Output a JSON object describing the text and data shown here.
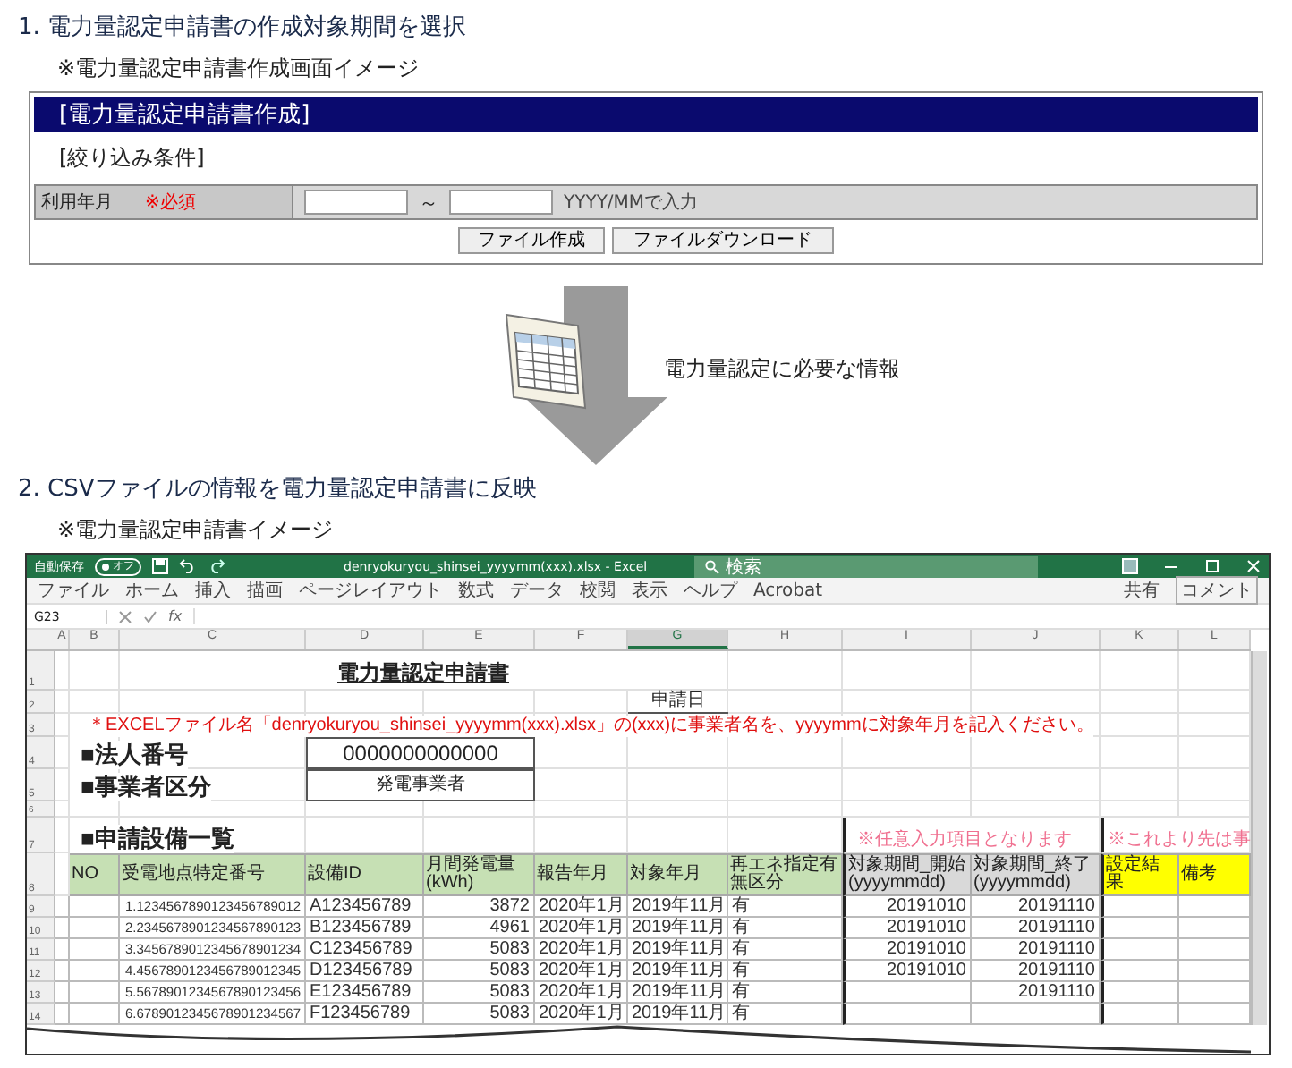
{
  "section1": {
    "heading": "1. 電力量認定申請書の作成対象期間を選択",
    "caption": "※電力量認定申請書作成画面イメージ",
    "form": {
      "title": "[電力量認定申請書作成]",
      "subtitle": "[絞り込み条件]",
      "field_label": "利用年月",
      "required": "※必須",
      "separator": "～",
      "hint": "YYYY/MMで入力",
      "buttons": [
        "ファイル作成",
        "ファイルダウンロード"
      ]
    }
  },
  "transition": {
    "label": "電力量認定に必要な情報"
  },
  "section2": {
    "heading": "2. CSVファイルの情報を電力量認定申請書に反映",
    "caption": "※電力量認定申請書イメージ",
    "excel": {
      "title_bar": {
        "autosave": "自動保存",
        "autosave_toggle": {
          "label": "オフ",
          "on": false
        },
        "filename": "denryokuryou_shinsei_yyyymm(xxx).xlsx - Excel",
        "search": "検索"
      },
      "menu": [
        "ファイル",
        "ホーム",
        "挿入",
        "描画",
        "ページレイアウト",
        "数式",
        "データ",
        "校閲",
        "表示",
        "ヘルプ",
        "Acrobat"
      ],
      "share": "共有",
      "comment": "コメント",
      "name_box": "G23",
      "function_label": "fx",
      "columns": [
        {
          "label": "A",
          "selected": false
        },
        {
          "label": "B",
          "selected": false
        },
        {
          "label": "C",
          "selected": false
        },
        {
          "label": "D",
          "selected": false
        },
        {
          "label": "E",
          "selected": false
        },
        {
          "label": "F",
          "selected": false
        },
        {
          "label": "G",
          "selected": true
        },
        {
          "label": "H",
          "selected": false
        },
        {
          "label": "I",
          "selected": false
        },
        {
          "label": "J",
          "selected": false
        },
        {
          "label": "K",
          "selected": false
        },
        {
          "label": "L",
          "selected": false
        }
      ],
      "row_numbers": [
        "1",
        "2",
        "3",
        "4",
        "5",
        "6",
        "7",
        "8"
      ],
      "sheet_title": "電力量認定申請書",
      "date_label": "申請日",
      "note": "＊EXCELファイル名「denryokuryou_shinsei_yyyymm(xxx).xlsx」の(xxx)に事業者名を、yyyymmに対象年月を記入ください。",
      "corp_number": {
        "label": "■法人番号",
        "value": "0000000000000"
      },
      "business_type": {
        "label": "■事業者区分",
        "value": "発電事業者"
      },
      "list_title": "■申請設備一覧",
      "optional_note": "※任意入力項目となります",
      "after_note": "※これより先は事",
      "headers": [
        {
          "label": "NO",
          "kind": "green"
        },
        {
          "label": "受電地点特定番号",
          "kind": "green"
        },
        {
          "label": "設備ID",
          "kind": "green"
        },
        {
          "label": "月間発電量(kWh)",
          "kind": "green"
        },
        {
          "label": "報告年月",
          "kind": "green"
        },
        {
          "label": "対象年月",
          "kind": "green"
        },
        {
          "label": "再エネ指定有無区分",
          "kind": "green"
        },
        {
          "label": "対象期間_開始(yyyymmdd)",
          "kind": "gray"
        },
        {
          "label": "対象期間_終了(yyyymmdd)",
          "kind": "gray"
        },
        {
          "label": "設定結果",
          "kind": "yellow"
        },
        {
          "label": "備考",
          "kind": "yellow"
        }
      ],
      "rows": [
        {
          "row": "9",
          "cells": [
            "",
            "",
            "1.1234567890123456789012",
            "A123456789",
            "3872",
            "2020年1月",
            "2019年11月",
            "有",
            "20191010",
            "20191110",
            "",
            ""
          ]
        },
        {
          "row": "10",
          "cells": [
            "",
            "",
            "2.2345678901234567890123",
            "B123456789",
            "4961",
            "2020年1月",
            "2019年11月",
            "有",
            "20191010",
            "20191110",
            "",
            ""
          ]
        },
        {
          "row": "11",
          "cells": [
            "",
            "",
            "3.3456789012345678901234",
            "C123456789",
            "5083",
            "2020年1月",
            "2019年11月",
            "有",
            "20191010",
            "20191110",
            "",
            ""
          ]
        },
        {
          "row": "12",
          "cells": [
            "",
            "",
            "4.4567890123456789012345",
            "D123456789",
            "5083",
            "2020年1月",
            "2019年11月",
            "有",
            "20191010",
            "20191110",
            "",
            ""
          ]
        },
        {
          "row": "13",
          "cells": [
            "",
            "",
            "5.5678901234567890123456",
            "E123456789",
            "5083",
            "2020年1月",
            "2019年11月",
            "有",
            "",
            "20191110",
            "",
            ""
          ]
        },
        {
          "row": "14",
          "cells": [
            "",
            "",
            "6.6789012345678901234567",
            "F123456789",
            "5083",
            "2020年1月",
            "2019年11月",
            "有",
            "",
            "",
            "",
            ""
          ]
        }
      ]
    }
  }
}
